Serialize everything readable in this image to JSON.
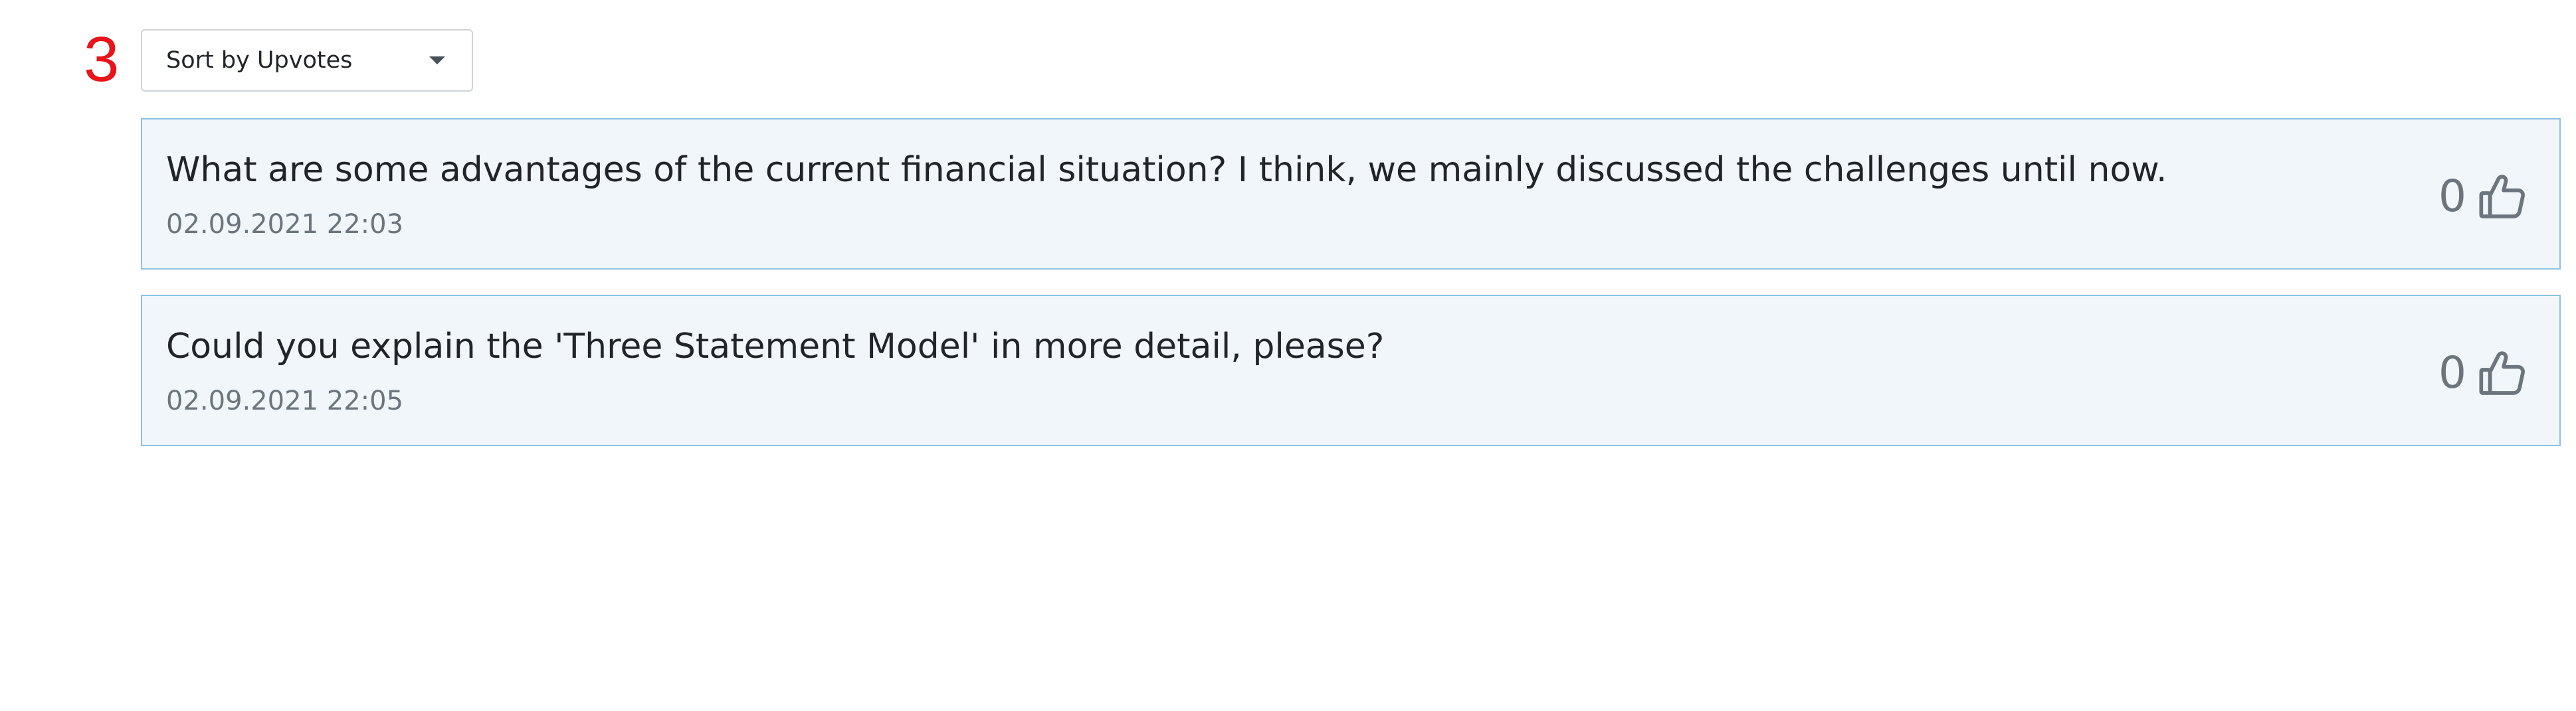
{
  "step_marker": "3",
  "sort": {
    "selected": "Sort by Upvotes"
  },
  "questions": [
    {
      "text": "What are some advantages of the current financial situation? I think, we mainly discussed the challenges until now.",
      "timestamp": "02.09.2021 22:03",
      "upvotes": "0",
      "icon": "thumbs-up-icon"
    },
    {
      "text": "Could you explain the 'Three Statement Model' in more detail, please?",
      "timestamp": "02.09.2021 22:05",
      "upvotes": "0",
      "icon": "thumbs-up-icon"
    }
  ],
  "colors": {
    "step_marker": "#e8141a",
    "card_background": "#f1f6fa",
    "card_border": "#8cc1e3",
    "muted_text": "#6c757d"
  }
}
